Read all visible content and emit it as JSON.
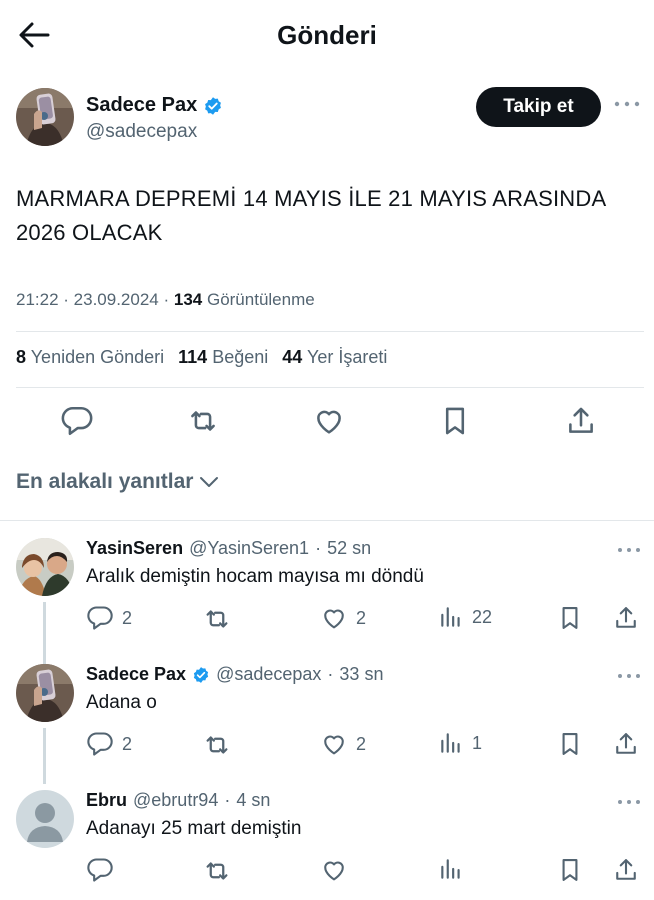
{
  "header": {
    "title": "Gönderi",
    "back_icon": "arrow-left-icon"
  },
  "post": {
    "author_name": "Sadece Pax",
    "author_handle": "@sadecepax",
    "verified": true,
    "follow_label": "Takip et",
    "text_lines": [
      "MARMARA DEPREMİ 14 MAYIS İLE 21 MAYIS ARASINDA",
      "2026 OLACAK"
    ],
    "time": "21:22",
    "date": "23.09.2024",
    "views_count": "134",
    "views_label": "Görüntülenme",
    "reposts_count": "8",
    "reposts_label": "Yeniden Gönderi",
    "likes_count": "114",
    "likes_label": "Beğeni",
    "bookmarks_count": "44",
    "bookmarks_label": "Yer İşareti"
  },
  "sort": {
    "label": "En alakalı yanıtlar",
    "icon": "chevron-down-icon"
  },
  "replies": [
    {
      "name": "YasinSeren",
      "handle": "@YasinSeren1",
      "time": "52 sn",
      "text": "Aralık demiştin hocam mayısa mı döndü",
      "replies": "2",
      "likes": "2",
      "views": "22",
      "verified": false
    },
    {
      "name": "Sadece Pax",
      "handle": "@sadecepax",
      "time": "33 sn",
      "text": "Adana o",
      "replies": "2",
      "likes": "2",
      "views": "1",
      "verified": true
    },
    {
      "name": "Ebru",
      "handle": "@ebrutr94",
      "time": "4 sn",
      "text": "Adanayı 25 mart demiştin",
      "replies": "",
      "likes": "",
      "views": "",
      "verified": false
    }
  ],
  "colors": {
    "text": "#0f1419",
    "secondary": "#536471",
    "verified": "#1d9bf0",
    "divider": "#e3e7ea",
    "thread": "#cfd9de"
  }
}
